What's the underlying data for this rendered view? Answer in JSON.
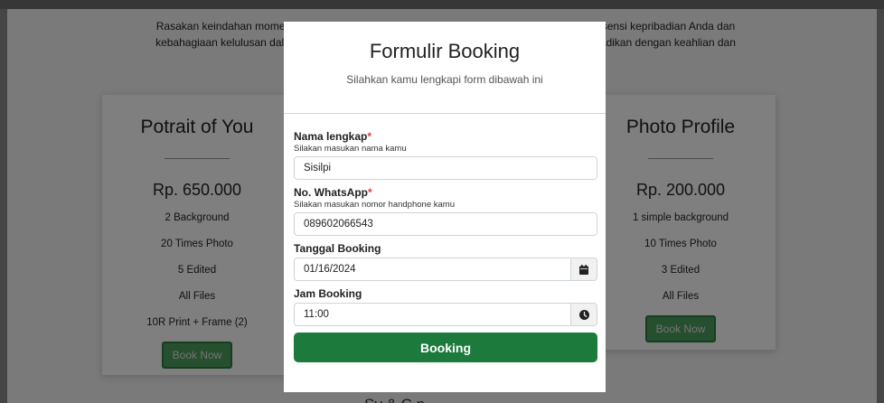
{
  "intro": {
    "line1": "Rasakan keindahan momen Anda dengan sentuhan profesional kami. Kami mengabadikan esensi kepribadian Anda dan",
    "line2": "kebahagiaan kelulusan dalam setiap bidikan, menciptakan kenangan abadi untuk Anda, diabadikan dengan keahlian dan"
  },
  "packages": [
    {
      "title": "Potrait of You",
      "price": "Rp. 650.000",
      "features": [
        "2 Background",
        "20 Times Photo",
        "5 Edited",
        "All Files",
        "10R Print + Frame (2)"
      ],
      "button": "Book Now"
    },
    {
      "title": "Photo Profile",
      "price": "Rp. 200.000",
      "features": [
        "1 simple background",
        "10 Times Photo",
        "3 Edited",
        "All Files"
      ],
      "button": "Book Now"
    }
  ],
  "next_section_peek": "Sy    & C    n",
  "modal": {
    "title": "Formulir Booking",
    "subtitle": "Silahkan kamu lengkapi form dibawah ini",
    "fields": {
      "name": {
        "label": "Nama lengkap",
        "required_mark": "*",
        "hint": "Silakan masukan nama kamu",
        "value": "Sisilpi"
      },
      "whatsapp": {
        "label": "No. WhatsApp",
        "required_mark": "*",
        "hint": "Silakan masukan nomor handphone kamu",
        "value": "089602066543"
      },
      "date": {
        "label": "Tanggal Booking",
        "value": "01/16/2024",
        "icon": "calendar-icon"
      },
      "time": {
        "label": "Jam Booking",
        "value": "11:00",
        "icon": "clock-icon"
      }
    },
    "submit_label": "Booking"
  },
  "colors": {
    "submit_bg": "#1b7a3c",
    "book_now_bg": "#4b9e5c",
    "required": "#e03a3a"
  }
}
